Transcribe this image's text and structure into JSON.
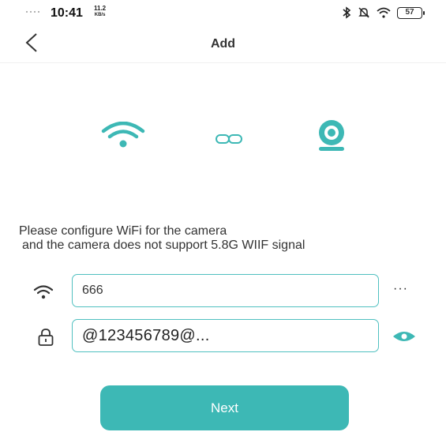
{
  "status_bar": {
    "time": "10:41",
    "net_speed_value": "11.2",
    "net_speed_unit": "KB/s",
    "battery": "57",
    "icons": [
      "signal-icon",
      "bluetooth-icon",
      "mute-icon",
      "wifi-icon",
      "battery-icon"
    ]
  },
  "header": {
    "title": "Add",
    "back_icon": "chevron-left-icon"
  },
  "illustration": {
    "icons": [
      "wifi-icon",
      "link-icon",
      "camera-icon"
    ]
  },
  "instructions": {
    "line1": "Please configure WiFi for the camera",
    "line2": "and the camera does not support 5.8G WIIF signal"
  },
  "form": {
    "ssid_value": "666",
    "password_value": "@123456789@...",
    "more_label": "···"
  },
  "next_button": {
    "label": "Next"
  },
  "colors": {
    "accent": "#3db8b5",
    "field_border": "#50c0c0"
  }
}
